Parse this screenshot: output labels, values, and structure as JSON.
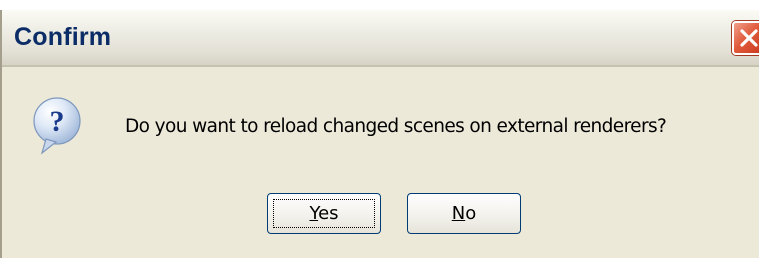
{
  "dialog": {
    "title": "Confirm",
    "message": "Do you want to reload changed scenes on external renderers?",
    "icon": "question-icon",
    "accent": "#0b2c66",
    "buttons": {
      "yes": {
        "mnemonic": "Y",
        "rest": "es"
      },
      "no": {
        "mnemonic": "N",
        "rest": "o"
      }
    }
  }
}
